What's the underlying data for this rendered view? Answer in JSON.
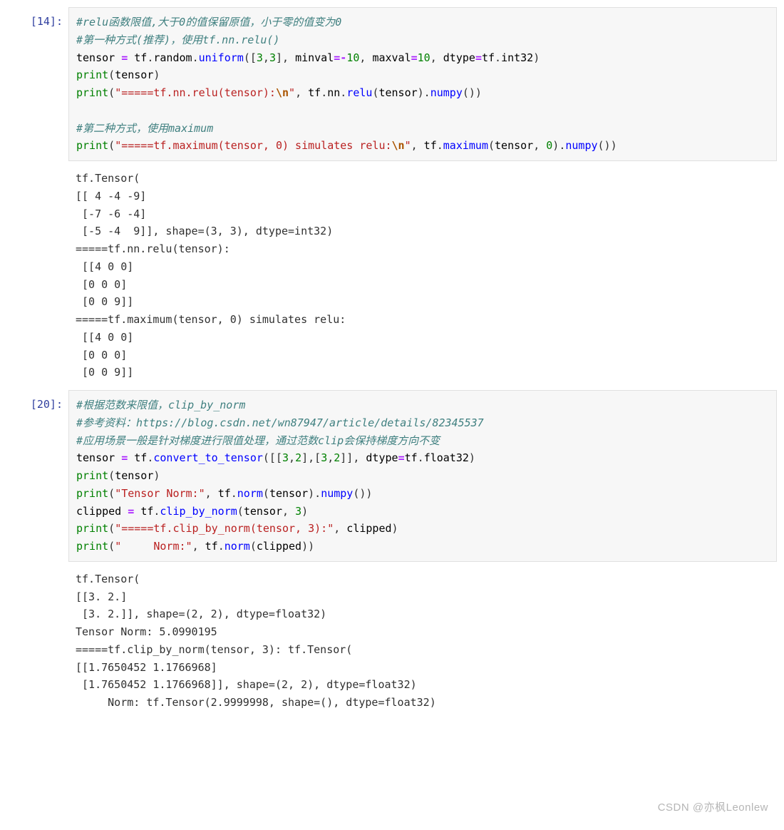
{
  "cells": [
    {
      "prompt": "[14]:",
      "code_html": "<span class=\"cm\">#relu函数限值,大于0的值保留原值，小于零的值变为0</span>\n<span class=\"cm\">#第一种方式(推荐)，使用tf.nn.relu()</span>\n<span class=\"nm\">tensor</span> <span class=\"op\">=</span> <span class=\"nm\">tf</span><span class=\"pn\">.</span><span class=\"nm\">random</span><span class=\"pn\">.</span><span class=\"fn\">uniform</span><span class=\"pn\">([</span><span class=\"num\">3</span><span class=\"pn\">,</span><span class=\"num\">3</span><span class=\"pn\">],</span> <span class=\"nm\">minval</span><span class=\"op\">=-</span><span class=\"num\">10</span><span class=\"pn\">,</span> <span class=\"nm\">maxval</span><span class=\"op\">=</span><span class=\"num\">10</span><span class=\"pn\">,</span> <span class=\"nm\">dtype</span><span class=\"op\">=</span><span class=\"nm\">tf</span><span class=\"pn\">.</span><span class=\"nm\">int32</span><span class=\"pn\">)</span>\n<span class=\"bn\">print</span><span class=\"pn\">(</span><span class=\"nm\">tensor</span><span class=\"pn\">)</span>\n<span class=\"bn\">print</span><span class=\"pn\">(</span><span class=\"str\">\"=====tf.nn.relu(tensor):</span><span class=\"esc\">\\n</span><span class=\"str\">\"</span><span class=\"pn\">,</span> <span class=\"nm\">tf</span><span class=\"pn\">.</span><span class=\"nm\">nn</span><span class=\"pn\">.</span><span class=\"fn\">relu</span><span class=\"pn\">(</span><span class=\"nm\">tensor</span><span class=\"pn\">).</span><span class=\"fn\">numpy</span><span class=\"pn\">())</span>\n\n<span class=\"cm\">#第二种方式，使用maximum</span>\n<span class=\"bn\">print</span><span class=\"pn\">(</span><span class=\"str\">\"=====tf.maximum(tensor, 0) simulates relu:</span><span class=\"esc\">\\n</span><span class=\"str\">\"</span><span class=\"pn\">,</span> <span class=\"nm\">tf</span><span class=\"pn\">.</span><span class=\"fn\">maximum</span><span class=\"pn\">(</span><span class=\"nm\">tensor</span><span class=\"pn\">,</span> <span class=\"num\">0</span><span class=\"pn\">).</span><span class=\"fn\">numpy</span><span class=\"pn\">())</span>",
      "output": "tf.Tensor(\n[[ 4 -4 -9]\n [-7 -6 -4]\n [-5 -4  9]], shape=(3, 3), dtype=int32)\n=====tf.nn.relu(tensor):\n [[4 0 0]\n [0 0 0]\n [0 0 9]]\n=====tf.maximum(tensor, 0) simulates relu:\n [[4 0 0]\n [0 0 0]\n [0 0 9]]"
    },
    {
      "prompt": "[20]:",
      "code_html": "<span class=\"cm\">#根据范数来限值，clip_by_norm</span>\n<span class=\"cm\">#参考资料：https://blog.csdn.net/wn87947/article/details/82345537</span>\n<span class=\"cm\">#应用场景一般是针对梯度进行限值处理，通过范数clip会保持梯度方向不变</span>\n<span class=\"nm\">tensor</span> <span class=\"op\">=</span> <span class=\"nm\">tf</span><span class=\"pn\">.</span><span class=\"fn\">convert_to_tensor</span><span class=\"pn\">([[</span><span class=\"num\">3</span><span class=\"pn\">,</span><span class=\"num\">2</span><span class=\"pn\">],[</span><span class=\"num\">3</span><span class=\"pn\">,</span><span class=\"num\">2</span><span class=\"pn\">]],</span> <span class=\"nm\">dtype</span><span class=\"op\">=</span><span class=\"nm\">tf</span><span class=\"pn\">.</span><span class=\"nm\">float32</span><span class=\"pn\">)</span>\n<span class=\"bn\">print</span><span class=\"pn\">(</span><span class=\"nm\">tensor</span><span class=\"pn\">)</span>\n<span class=\"bn\">print</span><span class=\"pn\">(</span><span class=\"str\">\"Tensor Norm:\"</span><span class=\"pn\">,</span> <span class=\"nm\">tf</span><span class=\"pn\">.</span><span class=\"fn\">norm</span><span class=\"pn\">(</span><span class=\"nm\">tensor</span><span class=\"pn\">).</span><span class=\"fn\">numpy</span><span class=\"pn\">())</span>\n<span class=\"nm\">clipped</span> <span class=\"op\">=</span> <span class=\"nm\">tf</span><span class=\"pn\">.</span><span class=\"fn\">clip_by_norm</span><span class=\"pn\">(</span><span class=\"nm\">tensor</span><span class=\"pn\">,</span> <span class=\"num\">3</span><span class=\"pn\">)</span>\n<span class=\"bn\">print</span><span class=\"pn\">(</span><span class=\"str\">\"=====tf.clip_by_norm(tensor, 3):\"</span><span class=\"pn\">,</span> <span class=\"nm\">clipped</span><span class=\"pn\">)</span>\n<span class=\"bn\">print</span><span class=\"pn\">(</span><span class=\"str\">\"     Norm:\"</span><span class=\"pn\">,</span> <span class=\"nm\">tf</span><span class=\"pn\">.</span><span class=\"fn\">norm</span><span class=\"pn\">(</span><span class=\"nm\">clipped</span><span class=\"pn\">))</span>",
      "output": "tf.Tensor(\n[[3. 2.]\n [3. 2.]], shape=(2, 2), dtype=float32)\nTensor Norm: 5.0990195\n=====tf.clip_by_norm(tensor, 3): tf.Tensor(\n[[1.7650452 1.1766968]\n [1.7650452 1.1766968]], shape=(2, 2), dtype=float32)\n     Norm: tf.Tensor(2.9999998, shape=(), dtype=float32)"
    }
  ],
  "watermark": "CSDN @亦枫Leonlew"
}
